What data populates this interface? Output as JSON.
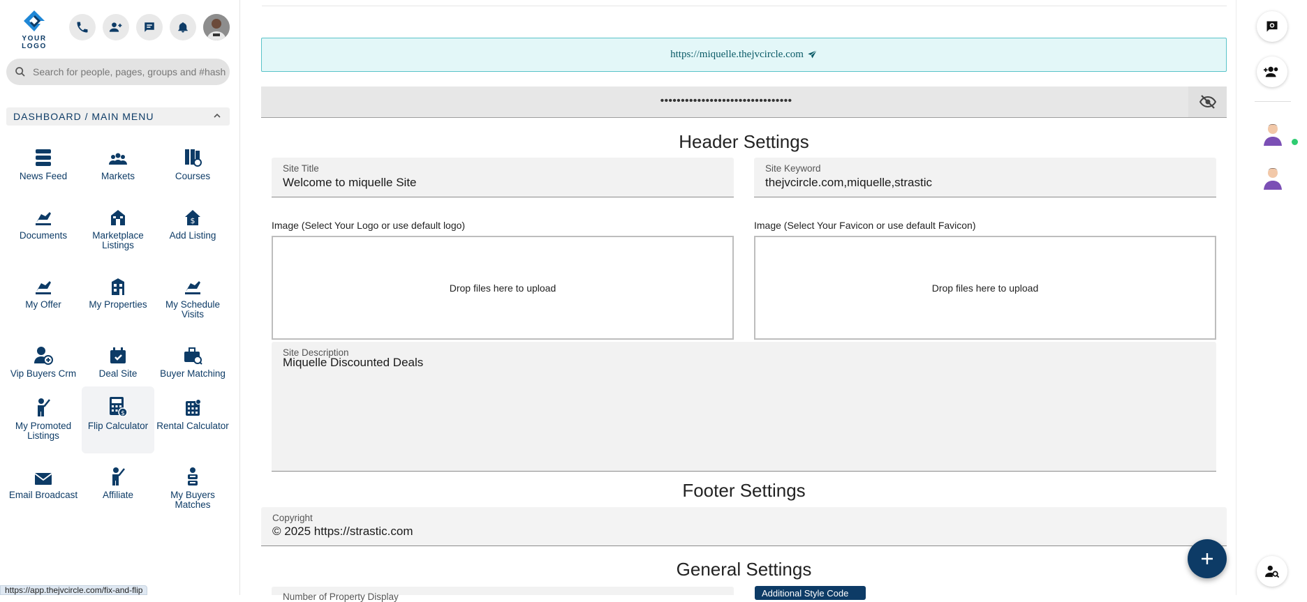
{
  "logo": {
    "text": "YOUR LOGO"
  },
  "search": {
    "placeholder": "Search for people, pages, groups and #hashtags"
  },
  "menu": {
    "title": "DASHBOARD / MAIN MENU",
    "items": [
      {
        "label": "News Feed"
      },
      {
        "label": "Markets"
      },
      {
        "label": "Courses"
      },
      {
        "label": "Documents"
      },
      {
        "label": "Marketplace Listings"
      },
      {
        "label": "Add Listing"
      },
      {
        "label": "My Offer"
      },
      {
        "label": "My Properties"
      },
      {
        "label": "My Schedule Visits"
      },
      {
        "label": "Vip Buyers Crm"
      },
      {
        "label": "Deal Site"
      },
      {
        "label": "Buyer Matching"
      },
      {
        "label": "My Promoted Listings"
      },
      {
        "label": "Flip Calculator"
      },
      {
        "label": "Rental Calculator"
      },
      {
        "label": "Email Broadcast"
      },
      {
        "label": "Affiliate"
      },
      {
        "label": "My Buyers Matches"
      }
    ],
    "active_item": "Flip Calculator"
  },
  "status_bar": {
    "url": "https://app.thejvcircle.com/fix-and-flip"
  },
  "main": {
    "site_url": "https://miquelle.thejvcircle.com",
    "password_mask": "••••••••••••••••••••••••••••••••",
    "header_settings": {
      "title": "Header Settings",
      "site_title": {
        "label": "Site Title",
        "value": "Welcome to miquelle Site"
      },
      "site_keyword": {
        "label": "Site Keyword",
        "value": "thejvcircle.com,miquelle,strastic"
      },
      "logo_image": {
        "label": "Image (Select Your Logo or use default logo)",
        "drop_text": "Drop files here to upload"
      },
      "favicon_image": {
        "label": "Image (Select Your Favicon or use default Favicon)",
        "drop_text": "Drop files here to upload"
      },
      "site_description": {
        "label": "Site Description",
        "value": "Miquelle Discounted Deals"
      }
    },
    "footer_settings": {
      "title": "Footer Settings",
      "copyright": {
        "label": "Copyright",
        "value": "© 2025 https://strastic.com"
      }
    },
    "general_settings": {
      "title": "General Settings",
      "property_display": {
        "label": "Number of Property Display"
      },
      "additional_code_button": "Additional Style Code"
    }
  },
  "colors": {
    "brand_navy": "#0d3b66",
    "url_bg": "#e3f7f8",
    "url_border": "#59c3c9",
    "online": "#2ecc71"
  }
}
